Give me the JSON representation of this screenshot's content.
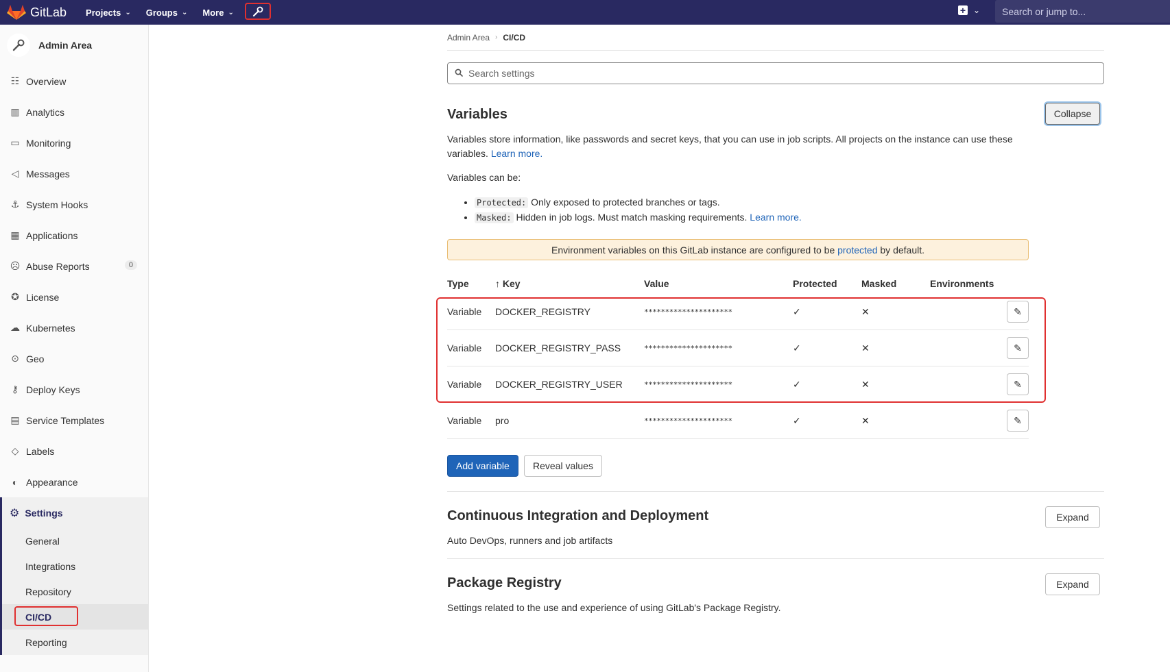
{
  "navbar": {
    "brand": "GitLab",
    "menu": [
      {
        "label": "Projects"
      },
      {
        "label": "Groups"
      },
      {
        "label": "More"
      }
    ],
    "search_placeholder": "Search or jump to..."
  },
  "sidebar": {
    "title": "Admin Area",
    "items": [
      {
        "label": "Overview",
        "icon": "overview-icon"
      },
      {
        "label": "Analytics",
        "icon": "analytics-icon"
      },
      {
        "label": "Monitoring",
        "icon": "monitoring-icon"
      },
      {
        "label": "Messages",
        "icon": "messages-icon"
      },
      {
        "label": "System Hooks",
        "icon": "hook-icon"
      },
      {
        "label": "Applications",
        "icon": "applications-icon"
      },
      {
        "label": "Abuse Reports",
        "icon": "abuse-icon",
        "badge": "0"
      },
      {
        "label": "License",
        "icon": "license-icon"
      },
      {
        "label": "Kubernetes",
        "icon": "kubernetes-icon"
      },
      {
        "label": "Geo",
        "icon": "geo-icon"
      },
      {
        "label": "Deploy Keys",
        "icon": "key-icon"
      },
      {
        "label": "Service Templates",
        "icon": "template-icon"
      },
      {
        "label": "Labels",
        "icon": "label-icon"
      },
      {
        "label": "Appearance",
        "icon": "appearance-icon"
      }
    ],
    "settings": {
      "label": "Settings",
      "sub": [
        "General",
        "Integrations",
        "Repository",
        "CI/CD",
        "Reporting"
      ],
      "active": "CI/CD"
    }
  },
  "breadcrumb": {
    "root": "Admin Area",
    "current": "CI/CD"
  },
  "search_settings": {
    "placeholder": "Search settings"
  },
  "variables": {
    "title": "Variables",
    "collapse_label": "Collapse",
    "desc": "Variables store information, like passwords and secret keys, that you can use in job scripts. All projects on the instance can use these variables.",
    "learn_more": "Learn more.",
    "can_be": "Variables can be:",
    "protected_tag": "Protected:",
    "protected_desc": "Only exposed to protected branches or tags.",
    "masked_tag": "Masked:",
    "masked_desc": "Hidden in job logs. Must match masking requirements.",
    "notice_pre": "Environment variables on this GitLab instance are configured to be",
    "notice_link": "protected",
    "notice_post": "by default.",
    "headers": {
      "type": "Type",
      "key": "Key",
      "value": "Value",
      "protected": "Protected",
      "masked": "Masked",
      "environments": "Environments"
    },
    "rows": [
      {
        "type": "Variable",
        "key": "DOCKER_REGISTRY",
        "value": "*********************"
      },
      {
        "type": "Variable",
        "key": "DOCKER_REGISTRY_PASS",
        "value": "*********************"
      },
      {
        "type": "Variable",
        "key": "DOCKER_REGISTRY_USER",
        "value": "*********************"
      },
      {
        "type": "Variable",
        "key": "pro",
        "value": "*********************"
      }
    ],
    "add_label": "Add variable",
    "reveal_label": "Reveal values"
  },
  "ci": {
    "title": "Continuous Integration and Deployment",
    "desc": "Auto DevOps, runners and job artifacts",
    "expand_label": "Expand"
  },
  "package": {
    "title": "Package Registry",
    "desc": "Settings related to the use and experience of using GitLab's Package Registry.",
    "expand_label": "Expand"
  },
  "colors": {
    "navbar": "#292961",
    "primary": "#1f64b8",
    "highlight": "#e03030",
    "notice": "#fdf1dd"
  }
}
